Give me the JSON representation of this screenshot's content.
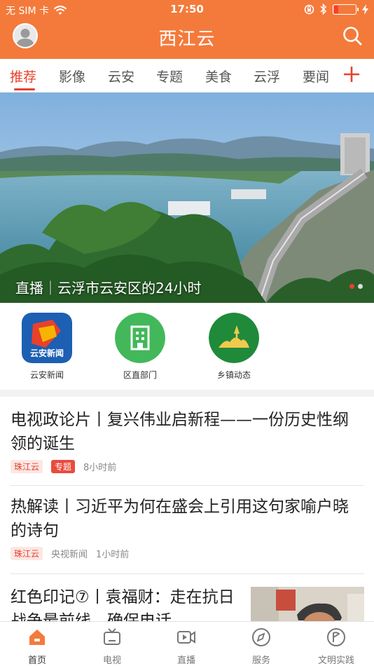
{
  "status_bar": {
    "carrier": "无 SIM 卡",
    "time": "17:50"
  },
  "header": {
    "title": "西江云"
  },
  "tabs": [
    {
      "label": "推荐",
      "active": true
    },
    {
      "label": "影像"
    },
    {
      "label": "云安"
    },
    {
      "label": "专题"
    },
    {
      "label": "美食"
    },
    {
      "label": "云浮"
    },
    {
      "label": "要闻"
    }
  ],
  "banner": {
    "caption": "直播｜云浮市云安区的24小时"
  },
  "quick_links": [
    {
      "label": "云安新闻",
      "icon": "yunan-news-logo",
      "logo_text": "云安新闻"
    },
    {
      "label": "区直部门",
      "icon": "building-icon"
    },
    {
      "label": "乡镇动态",
      "icon": "landscape-icon"
    }
  ],
  "articles": [
    {
      "title": "电视政论片丨复兴伟业启新程——一份历史性纲领的诞生",
      "source": "珠江云",
      "tag": "专题",
      "time": "8小时前"
    },
    {
      "title": "热解读丨习近平为何在盛会上引用这句家喻户晓的诗句",
      "source": "珠江云",
      "outlet": "央视新闻",
      "time": "1小时前"
    },
    {
      "title": "红色印记⑦丨袁福财：走在抗日战争最前线，确保电话"
    }
  ],
  "bottom_nav": [
    {
      "label": "首页",
      "icon": "home-icon",
      "active": true
    },
    {
      "label": "电视",
      "icon": "tv-icon"
    },
    {
      "label": "直播",
      "icon": "live-video-icon"
    },
    {
      "label": "服务",
      "icon": "compass-icon"
    },
    {
      "label": "文明实践",
      "icon": "flag-circle-icon"
    }
  ],
  "colors": {
    "brand": "#f47a3b",
    "accent": "#e8412c"
  }
}
